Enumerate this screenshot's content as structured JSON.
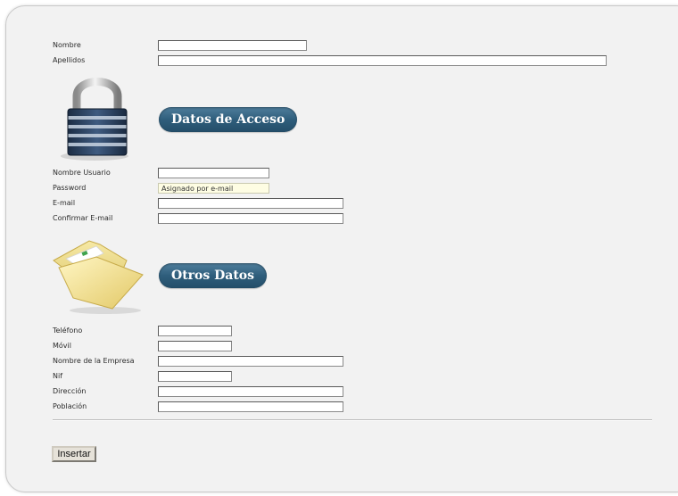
{
  "form": {
    "personal": {
      "nombre_label": "Nombre",
      "apellidos_label": "Apellidos"
    },
    "access_section": {
      "title": "Datos de Acceso",
      "icon": "padlock-icon",
      "usuario_label": "Nombre Usuario",
      "password_label": "Password",
      "password_value": "Asignado por e-mail",
      "email_label": "E-mail",
      "confirm_email_label": "Confirmar E-mail"
    },
    "other_section": {
      "title": "Otros Datos",
      "icon": "folder-icon",
      "telefono_label": "Teléfono",
      "movil_label": "Móvil",
      "empresa_label": "Nombre de la Empresa",
      "nif_label": "Nif",
      "direccion_label": "Dirección",
      "poblacion_label": "Población"
    },
    "submit_label": "Insertar"
  },
  "colors": {
    "panel_background": "#f2f2f2",
    "section_pill": "#2f5e7c",
    "readonly_field": "#fefde3"
  }
}
